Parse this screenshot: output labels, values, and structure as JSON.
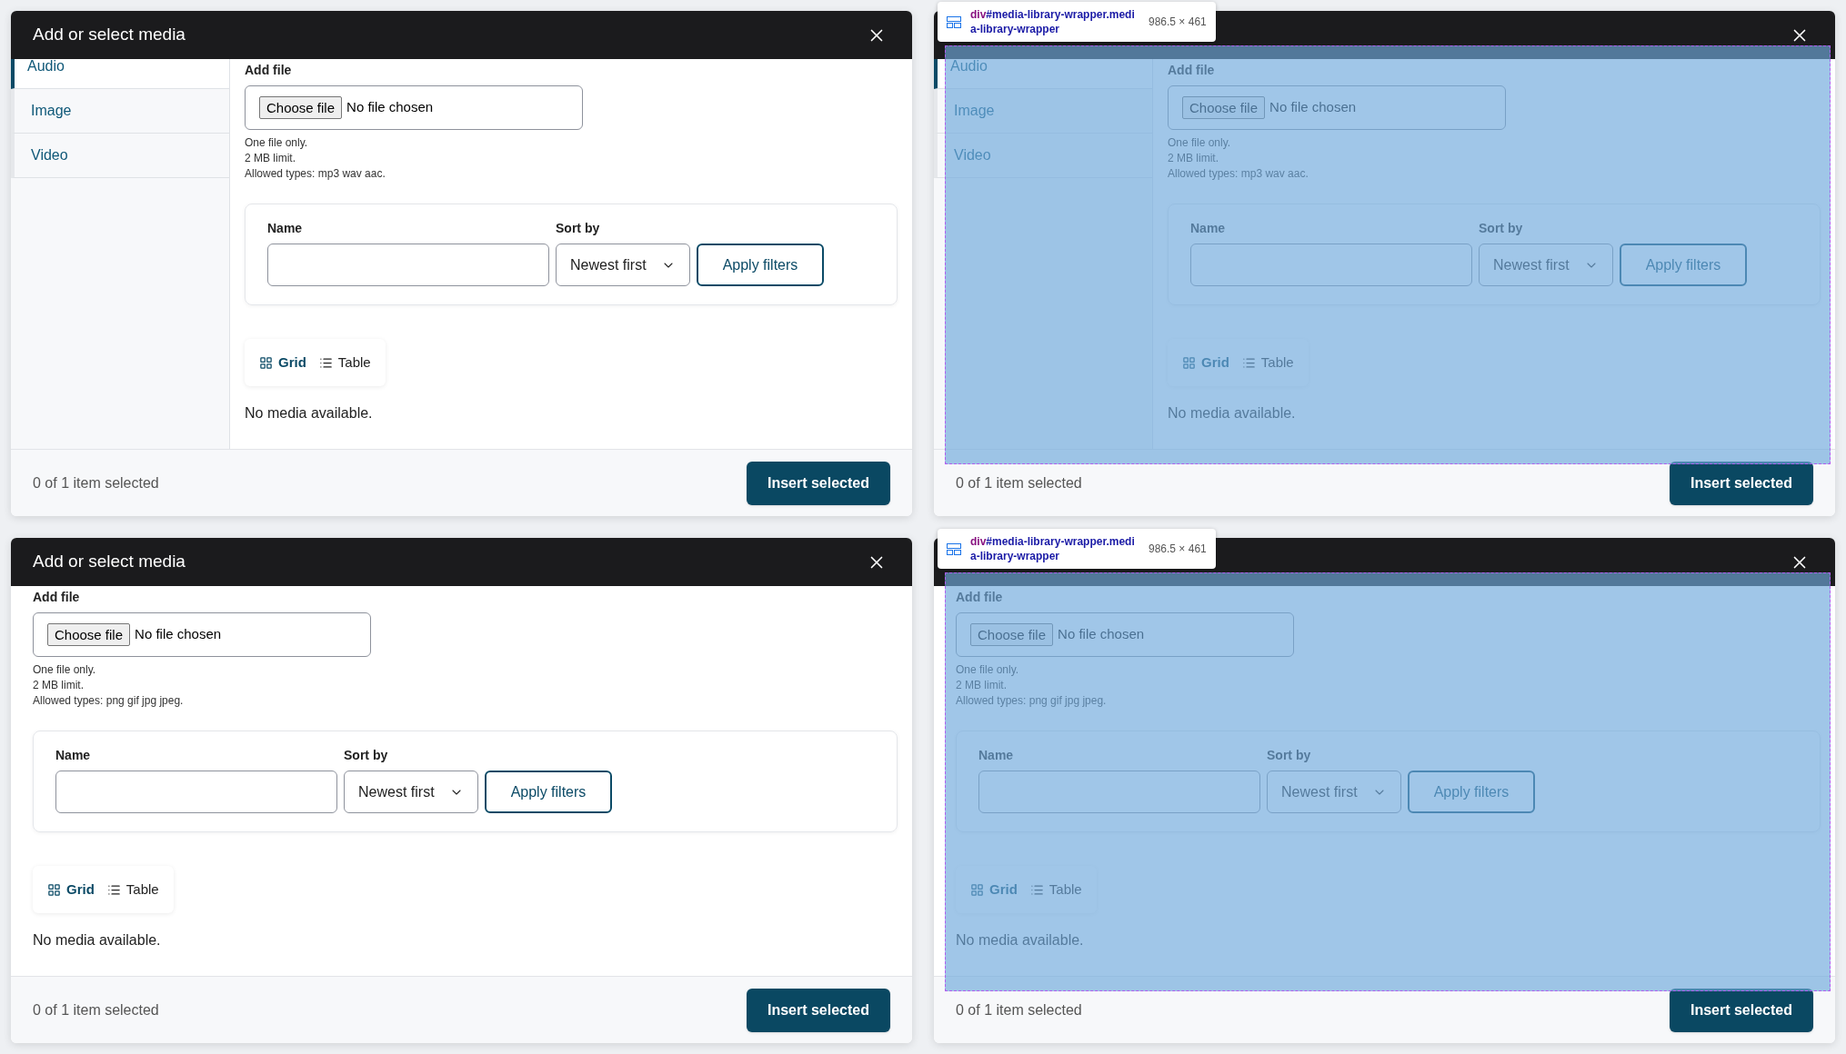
{
  "panels": [
    {
      "title": "Add or select media",
      "tabs": [
        {
          "label": "Audio",
          "selected": true
        },
        {
          "label": "Image",
          "selected": false
        },
        {
          "label": "Video",
          "selected": false
        }
      ],
      "add_file": {
        "label": "Add file",
        "button": "Choose file",
        "status": "No file chosen",
        "hints": [
          "One file only.",
          "2 MB limit.",
          "Allowed types: mp3 wav aac."
        ]
      },
      "filters": {
        "name_label": "Name",
        "sort_label": "Sort by",
        "sort_value": "Newest first",
        "apply": "Apply filters"
      },
      "views": [
        {
          "kind": "grid",
          "label": "Grid",
          "selected": true
        },
        {
          "kind": "table",
          "label": "Table",
          "selected": false
        }
      ],
      "empty": "No media available.",
      "footer": {
        "count": "0 of 1 item selected",
        "button": "Insert selected"
      }
    },
    {
      "tabs": [
        {
          "label": "Audio",
          "selected": true
        },
        {
          "label": "Image",
          "selected": false
        },
        {
          "label": "Video",
          "selected": false
        }
      ],
      "add_file": {
        "label": "Add file",
        "button": "Choose file",
        "status": "No file chosen",
        "hints": [
          "One file only.",
          "2 MB limit.",
          "Allowed types: mp3 wav aac."
        ]
      },
      "filters": {
        "name_label": "Name",
        "sort_label": "Sort by",
        "sort_value": "Newest first",
        "apply": "Apply filters"
      },
      "views": [
        {
          "kind": "grid",
          "label": "Grid",
          "selected": true
        },
        {
          "kind": "table",
          "label": "Table",
          "selected": false
        }
      ],
      "empty": "No media available.",
      "footer": {
        "count": "0 of 1 item selected",
        "button": "Insert selected"
      },
      "inspector": {
        "tag": "div",
        "selector": "#media-library-wrapper.media-library-wrapper",
        "size": "986.5 × 461"
      }
    },
    {
      "title": "Add or select media",
      "add_file": {
        "label": "Add file",
        "button": "Choose file",
        "status": "No file chosen",
        "hints": [
          "One file only.",
          "2 MB limit.",
          "Allowed types: png gif jpg jpeg."
        ]
      },
      "filters": {
        "name_label": "Name",
        "sort_label": "Sort by",
        "sort_value": "Newest first",
        "apply": "Apply filters"
      },
      "views": [
        {
          "kind": "grid",
          "label": "Grid",
          "selected": true
        },
        {
          "kind": "table",
          "label": "Table",
          "selected": false
        }
      ],
      "empty": "No media available.",
      "footer": {
        "count": "0 of 1 item selected",
        "button": "Insert selected"
      }
    },
    {
      "add_file": {
        "label": "Add file",
        "button": "Choose file",
        "status": "No file chosen",
        "hints": [
          "One file only.",
          "2 MB limit.",
          "Allowed types: png gif jpg jpeg."
        ]
      },
      "filters": {
        "name_label": "Name",
        "sort_label": "Sort by",
        "sort_value": "Newest first",
        "apply": "Apply filters"
      },
      "views": [
        {
          "kind": "grid",
          "label": "Grid",
          "selected": true
        },
        {
          "kind": "table",
          "label": "Table",
          "selected": false
        }
      ],
      "empty": "No media available.",
      "footer": {
        "count": "0 of 1 item selected",
        "button": "Insert selected"
      },
      "inspector": {
        "tag": "div",
        "selector": "#media-library-wrapper.media-library-wrapper",
        "size": "986.5 × 461"
      }
    }
  ]
}
